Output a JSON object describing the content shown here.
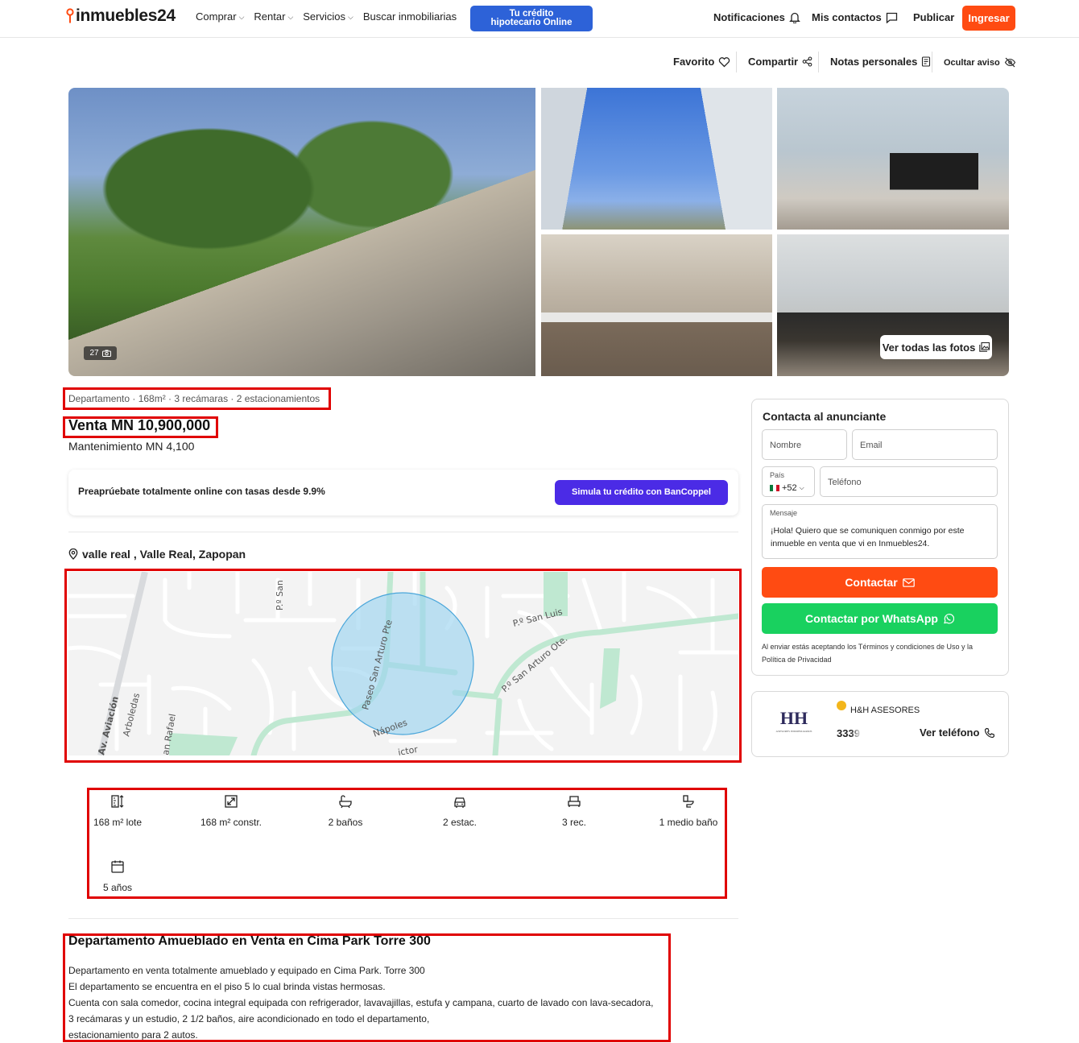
{
  "header": {
    "logo": "inmuebles24",
    "nav": [
      {
        "label": "Comprar",
        "has_dropdown": true
      },
      {
        "label": "Rentar",
        "has_dropdown": true
      },
      {
        "label": "Servicios",
        "has_dropdown": true
      },
      {
        "label": "Buscar inmobiliarias",
        "has_dropdown": false
      }
    ],
    "credit_button": {
      "line1": "Tu crédito",
      "line2": "hipotecario Online"
    },
    "notificaciones": "Notificaciones",
    "mis_contactos": "Mis contactos",
    "publicar": "Publicar",
    "ingresar": "Ingresar"
  },
  "actions": {
    "favorito": "Favorito",
    "compartir": "Compartir",
    "notas": "Notas personales",
    "ocultar": "Ocultar aviso"
  },
  "gallery": {
    "photo_count": "27",
    "ver_todas": "Ver todas las fotos"
  },
  "listing": {
    "subtitle": "Departamento · 168m² · 3 recámaras · 2 estacionamientos",
    "price": "Venta MN 10,900,000",
    "maintenance": "Mantenimiento MN 4,100",
    "preap_text": "Preaprúebate totalmente online con tasas desde 9.9%",
    "simula_button": "Simula tu crédito con BanCoppel",
    "address": "valle real , Valle Real, Zapopan"
  },
  "map": {
    "streets": [
      "P.º San",
      "P.º San Luis",
      "Paseo San Arturo Pte",
      "P.º San Arturo Ote.",
      "Av. Aviación",
      "Arboledas",
      "an Rafael",
      "Nápoles",
      "ictor"
    ]
  },
  "features": [
    {
      "icon": "lot-size-icon",
      "label": "168 m² lote"
    },
    {
      "icon": "construction-size-icon",
      "label": "168 m² constr."
    },
    {
      "icon": "bathtub-icon",
      "label": "2 baños"
    },
    {
      "icon": "car-icon",
      "label": "2 estac."
    },
    {
      "icon": "bed-icon",
      "label": "3 rec."
    },
    {
      "icon": "toilet-icon",
      "label": "1 medio baño"
    },
    {
      "icon": "calendar-icon",
      "label": "5 años"
    }
  ],
  "description": {
    "title": "Departamento Amueblado en Venta en Cima Park Torre 300",
    "lines": [
      "Departamento en venta totalmente amueblado y equipado en Cima Park. Torre 300",
      "El departamento se encuentra en el piso 5 lo cual brinda vistas hermosas.",
      "Cuenta con sala comedor, cocina integral equipada con refrigerador, lavavajillas, estufa y campana, cuarto de lavado con lava-secadora,",
      "3 recámaras y un estudio, 2 1/2 baños, aire acondicionado en todo el departamento,",
      "estacionamiento para 2 autos."
    ]
  },
  "contact": {
    "title": "Contacta al anunciante",
    "nombre_placeholder": "Nombre",
    "email_placeholder": "Email",
    "pais_label": "País",
    "pais_value": "+52",
    "telefono_placeholder": "Teléfono",
    "mensaje_label": "Mensaje",
    "mensaje_value": "¡Hola! Quiero que se comuniquen conmigo por este inmueble en venta que vi en Inmuebles24.",
    "contactar_button": "Contactar",
    "whatsapp_button": "Contactar por WhatsApp",
    "terms_line1": "Al enviar estás aceptando los Términos y condiciones de Uso y la",
    "terms_line2": "Política de Privacidad"
  },
  "agency": {
    "logo_text": "HH",
    "logo_sub": "ASESORES INMOBILIARIOS",
    "name": "H&H ASESORES",
    "phone_partial": "3339",
    "ver_telefono": "Ver teléfono"
  },
  "colors": {
    "brand_orange": "#ff4b12",
    "credit_blue": "#2d62d8",
    "bancoppel_purple": "#4b2be6",
    "whatsapp_green": "#19d15f",
    "highlight_red": "#e00000"
  }
}
